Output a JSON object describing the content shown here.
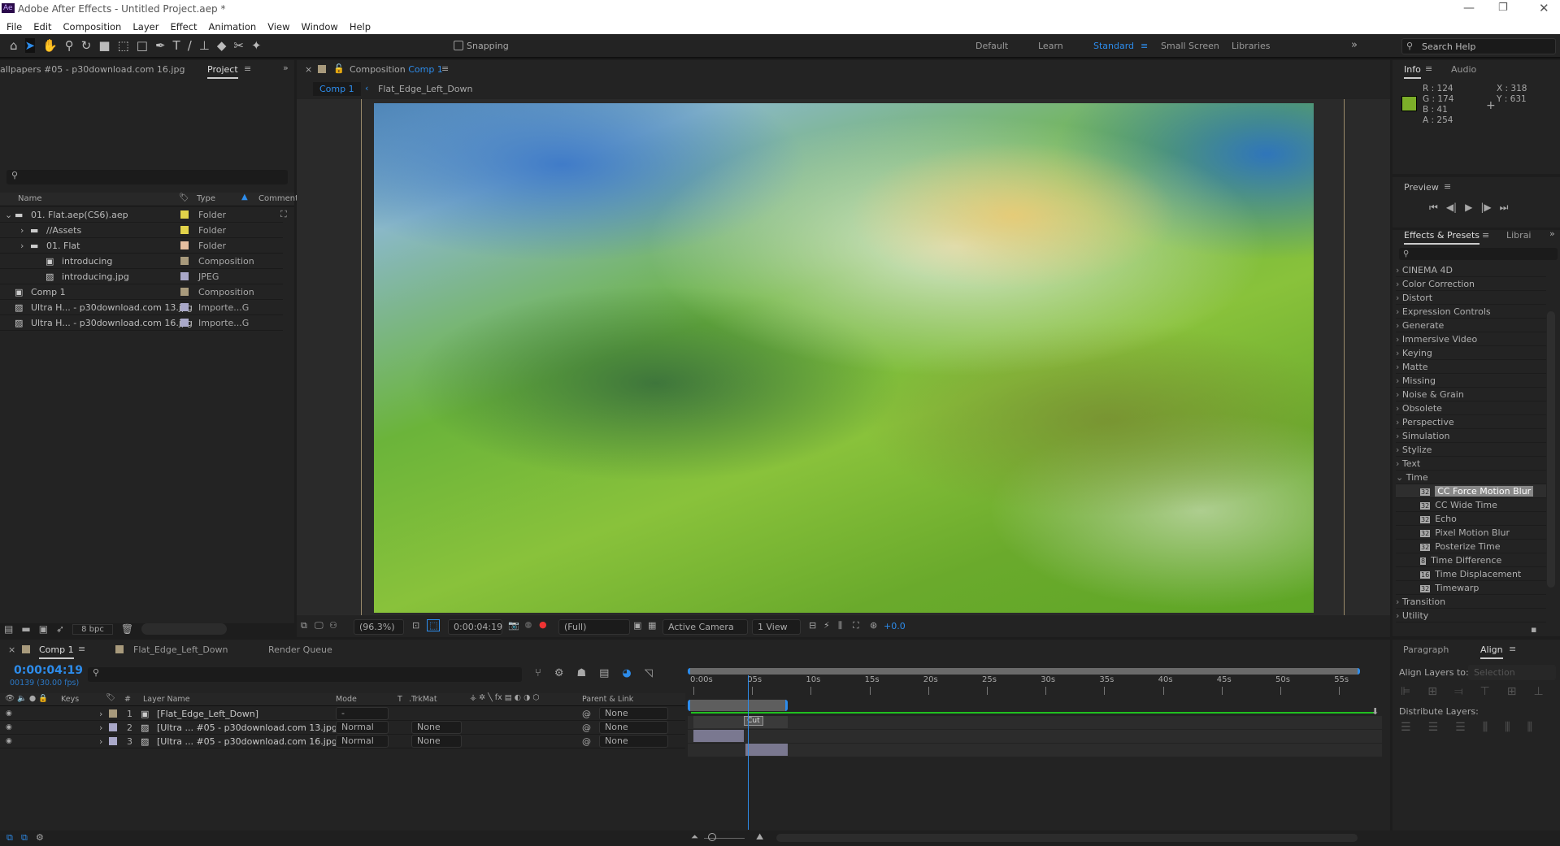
{
  "app": {
    "title": "Adobe After Effects - Untitled Project.aep *",
    "logo": "Ae"
  },
  "menu": [
    "File",
    "Edit",
    "Composition",
    "Layer",
    "Effect",
    "Animation",
    "View",
    "Window",
    "Help"
  ],
  "toolbar": {
    "snapping": "Snapping",
    "workspaces": [
      "Default",
      "Learn",
      "Standard",
      "Small Screen",
      "Libraries"
    ],
    "active_workspace": "Standard",
    "search_placeholder": "Search Help"
  },
  "project": {
    "footage_label": "allpapers #05 - p30download.com 16.jpg",
    "tab": "Project",
    "search_placeholder": "",
    "columns": {
      "name": "Name",
      "type": "Type",
      "comment": "Comment"
    },
    "items": [
      {
        "name": "01. Flat.aep(CS6).aep",
        "type": "Folder",
        "color": "#e2d34a",
        "indent": 0,
        "icon": "folder-icon",
        "expand": "⌄"
      },
      {
        "name": "//Assets",
        "type": "Folder",
        "color": "#e2d34a",
        "indent": 1,
        "icon": "folder-icon",
        "expand": "›"
      },
      {
        "name": "01. Flat",
        "type": "Folder",
        "color": "#e6bfa0",
        "indent": 1,
        "icon": "folder-icon",
        "expand": "›"
      },
      {
        "name": "introducing",
        "type": "Composition",
        "color": "#a89a7c",
        "indent": 2,
        "icon": "composition-icon",
        "expand": ""
      },
      {
        "name": "introducing.jpg",
        "type": "JPEG",
        "color": "#a9a8c8",
        "indent": 2,
        "icon": "image-icon",
        "expand": ""
      },
      {
        "name": "Comp 1",
        "type": "Composition",
        "color": "#a89a7c",
        "indent": 0,
        "icon": "composition-icon",
        "expand": ""
      },
      {
        "name": "Ultra H... - p30download.com 13.jpg",
        "type": "Importe...G",
        "color": "#a9a8c8",
        "indent": 0,
        "icon": "image-icon",
        "expand": ""
      },
      {
        "name": "Ultra H... - p30download.com 16.jpg",
        "type": "Importe...G",
        "color": "#a9a8c8",
        "indent": 0,
        "icon": "image-icon",
        "expand": ""
      }
    ],
    "bpc": "8 bpc"
  },
  "viewer": {
    "panel_label": "Composition",
    "comp_name": "Comp 1",
    "breadcrumbs": [
      "Comp 1",
      "Flat_Edge_Left_Down"
    ],
    "zoom": "(96.3%)",
    "timecode": "0:00:04:19",
    "resolution": "(Full)",
    "camera": "Active Camera",
    "views": "1 View",
    "exposure": "+0.0"
  },
  "info": {
    "tabs": [
      "Info",
      "Audio"
    ],
    "r": "124",
    "g": "174",
    "b": "41",
    "a": "254",
    "x": "318",
    "y": "631",
    "swatch": "#7cae29"
  },
  "preview": {
    "title": "Preview"
  },
  "effects": {
    "tabs": [
      "Effects & Presets",
      "Librai"
    ],
    "categories_before": [
      "CINEMA 4D",
      "Color Correction",
      "Distort",
      "Expression Controls",
      "Generate",
      "Immersive Video",
      "Keying",
      "Matte",
      "Missing",
      "Noise & Grain",
      "Obsolete",
      "Perspective",
      "Simulation",
      "Stylize",
      "Text"
    ],
    "open_category": "Time",
    "time_effects": [
      {
        "name": "CC Force Motion Blur",
        "bpc": "32"
      },
      {
        "name": "CC Wide Time",
        "bpc": "32"
      },
      {
        "name": "Echo",
        "bpc": "32"
      },
      {
        "name": "Pixel Motion Blur",
        "bpc": "32"
      },
      {
        "name": "Posterize Time",
        "bpc": "32"
      },
      {
        "name": "Time Difference",
        "bpc": "8"
      },
      {
        "name": "Time Displacement",
        "bpc": "16"
      },
      {
        "name": "Timewarp",
        "bpc": "32"
      }
    ],
    "selected": "CC Force Motion Blur",
    "categories_after": [
      "Transition",
      "Utility"
    ]
  },
  "align": {
    "tabs": [
      "Paragraph",
      "Align"
    ],
    "align_to_label": "Align Layers to:",
    "align_to_value": "Selection",
    "distribute_label": "Distribute Layers:"
  },
  "timeline": {
    "tabs": [
      "Comp 1",
      "Flat_Edge_Left_Down",
      "Render Queue"
    ],
    "timecode": "0:00:04:19",
    "frames": "00139 (30.00 fps)",
    "columns": {
      "keys": "Keys",
      "num": "#",
      "layer_name": "Layer Name",
      "mode": "Mode",
      "t": "T",
      "trkmat": ".TrkMat",
      "parent": "Parent & Link"
    },
    "ruler": [
      "0:00s",
      "05s",
      "10s",
      "15s",
      "20s",
      "25s",
      "30s",
      "35s",
      "40s",
      "45s",
      "50s",
      "55s"
    ],
    "current_time_s": 4.63,
    "work_area_end_s": 8,
    "layers": [
      {
        "num": "1",
        "name": "[Flat_Edge_Left_Down]",
        "mode": "-",
        "trkmat": "",
        "parent": "None",
        "color": "#a89a7c",
        "icon": "composition-icon",
        "in": 0,
        "out": 8
      },
      {
        "num": "2",
        "name": "[Ultra ... #05 - p30download.com 13.jpg]",
        "mode": "Normal",
        "trkmat": "None",
        "parent": "None",
        "color": "#a9a8c8",
        "icon": "image-icon",
        "in": 0,
        "out": 4.3
      },
      {
        "num": "3",
        "name": "[Ultra ... #05 - p30download.com 16.jpg]",
        "mode": "Normal",
        "trkmat": "None",
        "parent": "None",
        "color": "#a9a8c8",
        "icon": "image-icon",
        "in": 4.4,
        "out": 8
      }
    ],
    "marker": "Cut"
  }
}
